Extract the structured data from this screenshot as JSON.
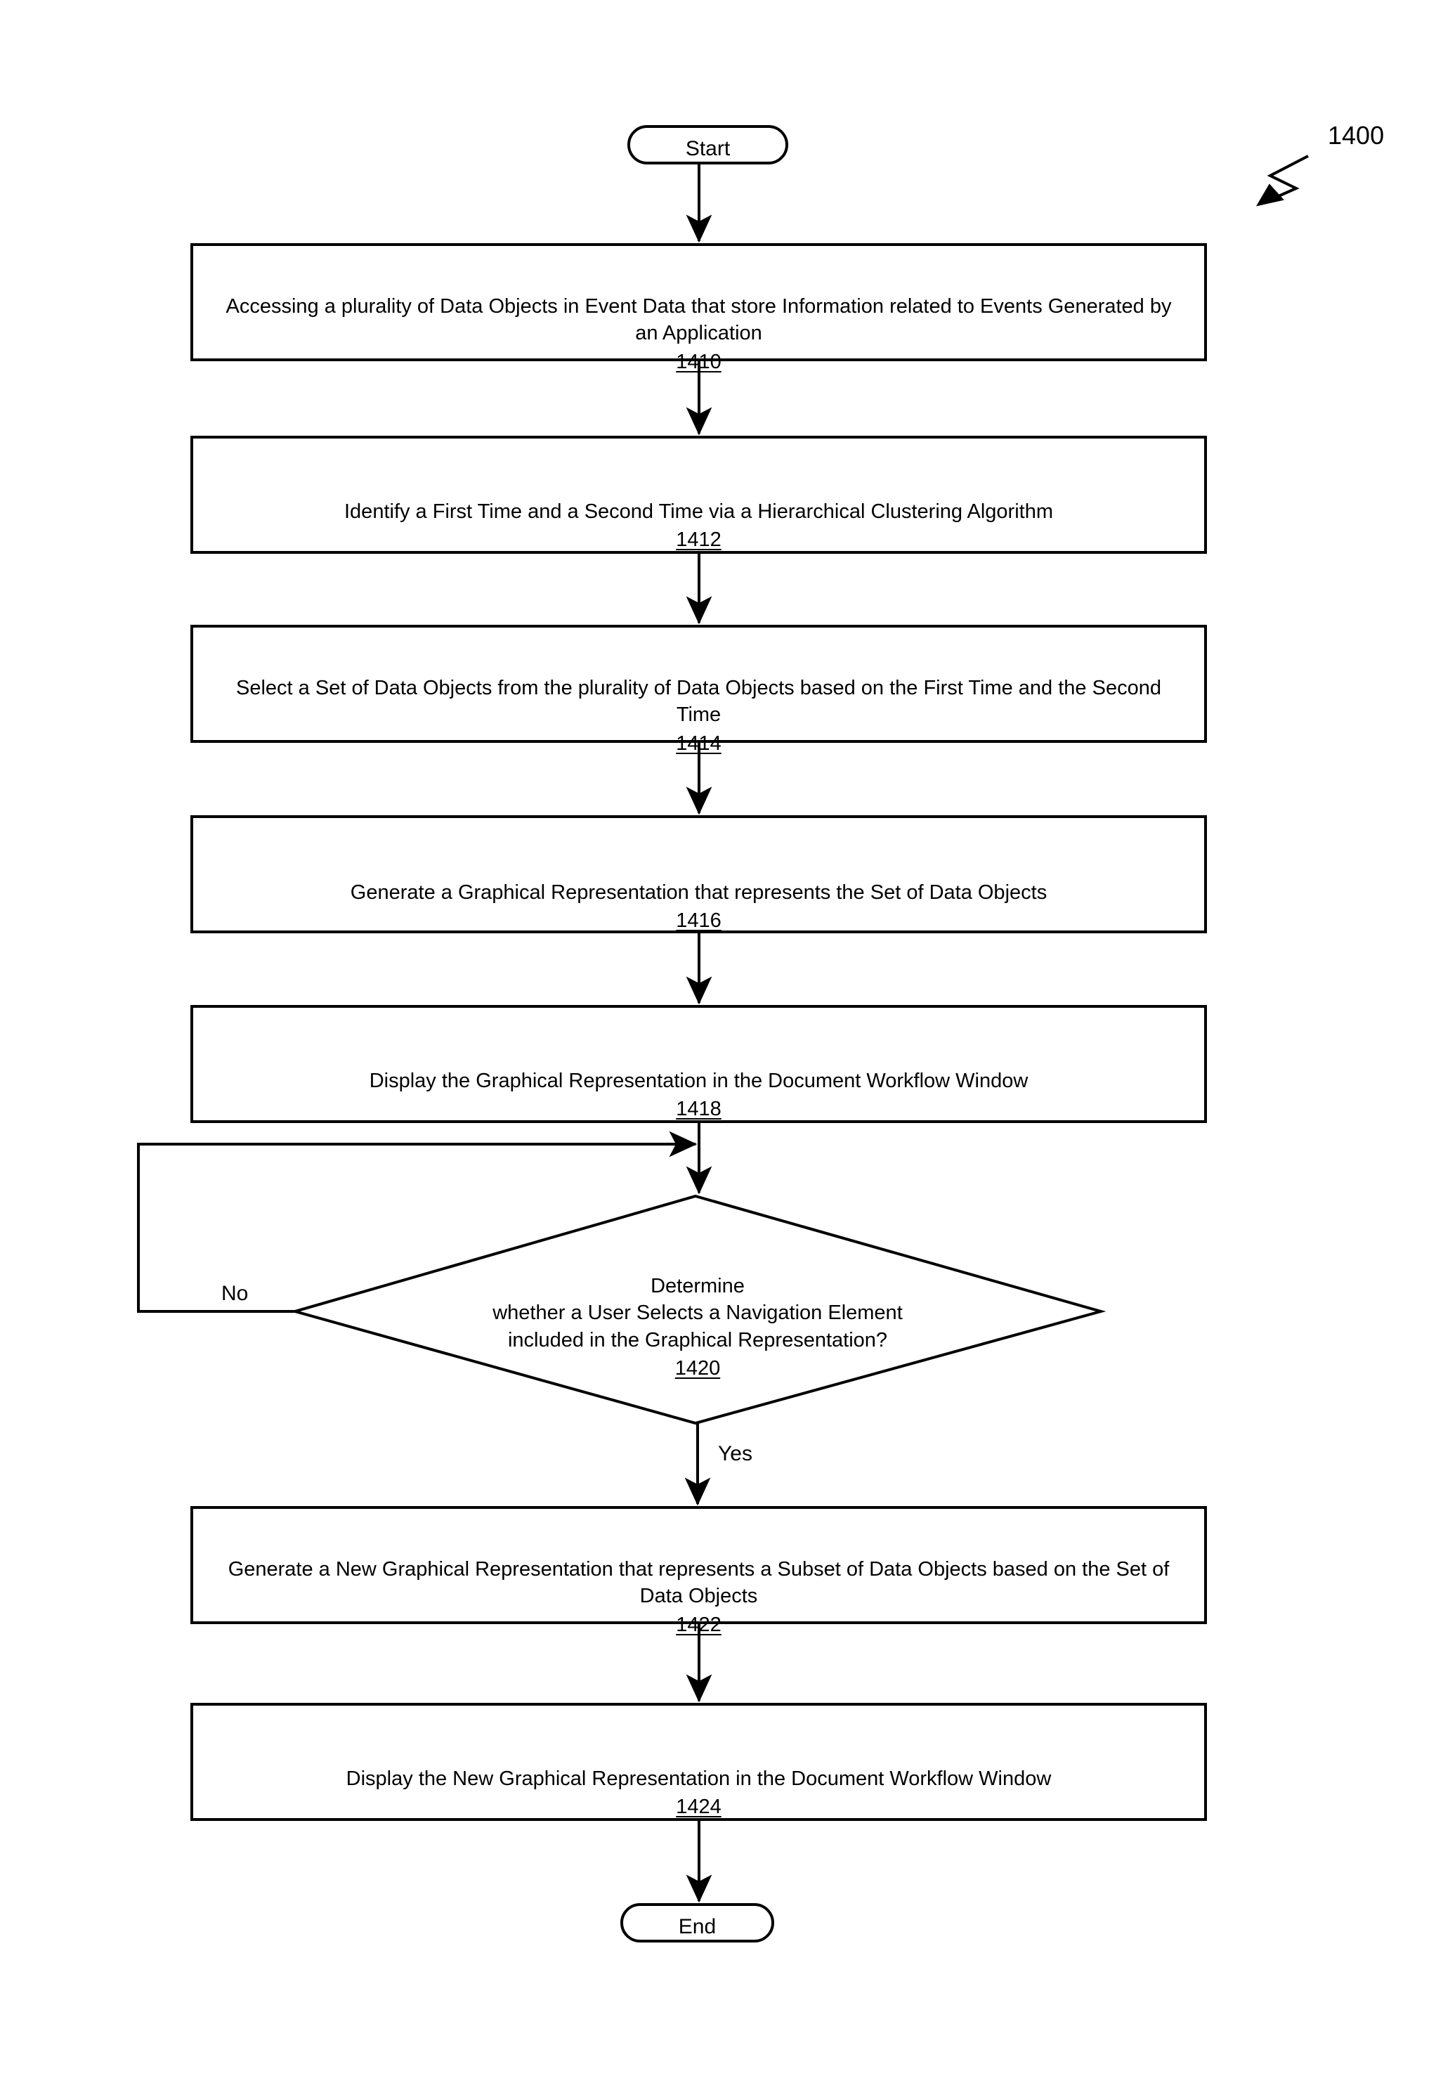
{
  "figure": {
    "reference_number": "1400"
  },
  "nodes": {
    "start": {
      "label": "Start",
      "shape": "terminator"
    },
    "step_1410": {
      "text": "Accessing a plurality of Data Objects in Event Data that store Information related to Events Generated by an Application",
      "id": "1410",
      "shape": "process"
    },
    "step_1412": {
      "text": "Identify a First Time and a Second Time via a Hierarchical Clustering Algorithm",
      "id": "1412",
      "shape": "process"
    },
    "step_1414": {
      "text": "Select a Set of Data Objects from the plurality of Data Objects based on the First Time and the Second Time",
      "id": "1414",
      "shape": "process"
    },
    "step_1416": {
      "text": "Generate a Graphical Representation that represents the Set of Data Objects",
      "id": "1416",
      "shape": "process"
    },
    "step_1418": {
      "text": "Display the Graphical Representation in the Document Workflow Window",
      "id": "1418",
      "shape": "process"
    },
    "step_1420": {
      "text": "Determine\nwhether a User Selects a Navigation Element\nincluded in the Graphical Representation?",
      "id": "1420",
      "shape": "decision"
    },
    "step_1422": {
      "text": "Generate a New Graphical Representation that represents a Subset of Data Objects based on the Set of Data Objects",
      "id": "1422",
      "shape": "process"
    },
    "step_1424": {
      "text": "Display the New Graphical Representation in the Document Workflow Window",
      "id": "1424",
      "shape": "process"
    },
    "end": {
      "label": "End",
      "shape": "terminator"
    }
  },
  "edge_labels": {
    "no": "No",
    "yes": "Yes"
  },
  "colors": {
    "stroke": "#000000",
    "fill": "#ffffff",
    "text": "#000000"
  }
}
